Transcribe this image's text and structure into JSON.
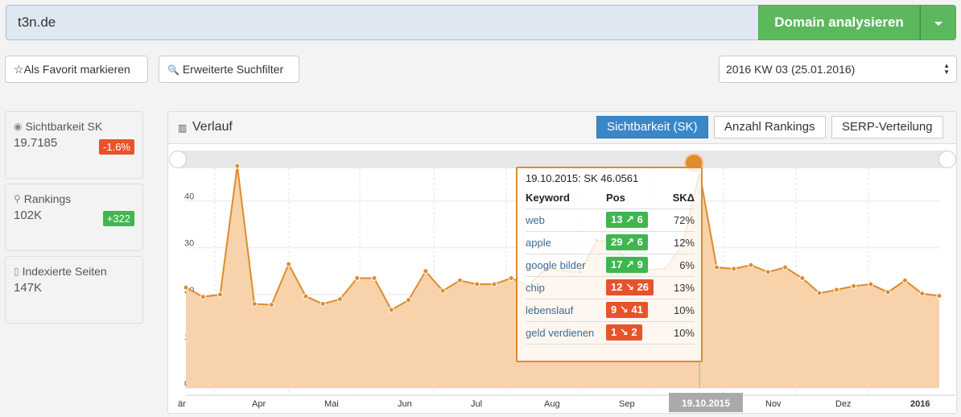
{
  "search": {
    "value": "t3n.de",
    "analyze_label": "Domain analysieren"
  },
  "toolbar": {
    "favorite_label": "Als Favorit markieren",
    "filter_label": "Erweiterte Suchfilter",
    "week_selected": "2016 KW 03 (25.01.2016)"
  },
  "stats": [
    {
      "label": "Sichtbarkeit SK",
      "value": "19.7185",
      "badge": "-1.6%",
      "badge_color": "#e8532b",
      "icon": "eye-icon"
    },
    {
      "label": "Rankings",
      "value": "102K",
      "badge": "+322",
      "badge_color": "#3fb650",
      "icon": "key-icon"
    },
    {
      "label": "Indexierte Seiten",
      "value": "147K",
      "icon": "file-icon"
    }
  ],
  "panel": {
    "title": "Verlauf",
    "tabs": [
      "Sichtbarkeit (SK)",
      "Anzahl Rankings",
      "SERP-Verteilung"
    ],
    "active_tab": 0
  },
  "tooltip": {
    "title": "19.10.2015: SK 46.0561",
    "headers": [
      "Keyword",
      "Pos",
      "SKΔ"
    ],
    "rows": [
      {
        "keyword": "web",
        "pos": "13 ↗ 6",
        "dir": "up",
        "skd": "72%"
      },
      {
        "keyword": "apple",
        "pos": "29 ↗ 6",
        "dir": "up",
        "skd": "12%"
      },
      {
        "keyword": "google bilder",
        "pos": "17 ↗ 9",
        "dir": "up",
        "skd": "6%"
      },
      {
        "keyword": "chip",
        "pos": "12 ↘ 26",
        "dir": "down",
        "skd": "13%"
      },
      {
        "keyword": "lebenslauf",
        "pos": "9 ↘ 41",
        "dir": "down",
        "skd": "10%"
      },
      {
        "keyword": "geld verdienen",
        "pos": "1 ↘ 2",
        "dir": "down",
        "skd": "10%"
      }
    ]
  },
  "chart_data": {
    "type": "area",
    "y_ticks": [
      "0",
      "10",
      "20",
      "30",
      "40"
    ],
    "ylim": [
      0,
      47
    ],
    "x_labels": [
      "är",
      "Apr",
      "Mai",
      "Jun",
      "Jul",
      "Aug",
      "Sep",
      "19.10.2015",
      "Nov",
      "Dez",
      "2016"
    ],
    "highlight_label": "19.10.2015",
    "color": "#e08b2c",
    "fill": "#f7d2aa",
    "values": [
      21.5,
      19.5,
      20,
      47.5,
      18,
      17.8,
      26.5,
      19.6,
      18,
      19,
      23.5,
      23.5,
      16.7,
      18.8,
      25,
      20.8,
      23,
      22.2,
      22.2,
      23.5,
      21.9,
      25.5,
      25,
      24.8,
      31.5,
      31.3,
      25.5,
      25.3,
      25.5,
      30.5,
      46.0561,
      25.8,
      25.5,
      26.3,
      24.8,
      25.8,
      23.5,
      20.3,
      21,
      21.8,
      22.2,
      20.5,
      23,
      20.2,
      19.7185
    ]
  }
}
